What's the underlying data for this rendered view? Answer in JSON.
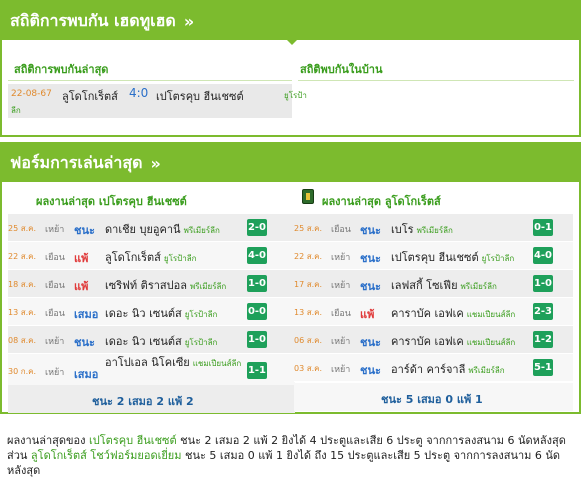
{
  "h2h": {
    "title": "สถิติการพบกัน เฮดทูเฮด",
    "chevron": "»",
    "latest_label": "สถิติการพบกันล่าสุด",
    "home_label": "สถิติพบกันในบ้าน",
    "match": {
      "date": "22-08-67",
      "home": "ลูโดโกเร็ตส์",
      "score": "4:0",
      "away": "เปโตรคุบ ฮีนเชซต์",
      "league": "ยูโรป้า",
      "league2": "ลีก"
    }
  },
  "form": {
    "title": "ฟอร์มการเล่นล่าสุด",
    "chevron": "»",
    "left_label": "ผลงานล่าสุด เปโตรคุบ ฮีนเชซต์",
    "right_label": "ผลงานล่าสุด ลูโดโกเร็ตส์",
    "team_icon": "ludogorets-crest-icon",
    "left_rows": [
      {
        "date": "25 ส.ค.",
        "ha": "เหย้า",
        "res": "ชนะ",
        "type": "win",
        "opp": "ดาเชีย บุยอูคานี",
        "lg": "พรีเมียร์ลีก",
        "score": "2-0"
      },
      {
        "date": "22 ส.ค.",
        "ha": "เยือน",
        "res": "แพ้",
        "type": "lose",
        "opp": "ลูโดโกเร็ตส์",
        "lg": "ยูโรป้าลีก",
        "score": "4-0"
      },
      {
        "date": "18 ส.ค.",
        "ha": "เยือน",
        "res": "แพ้",
        "type": "lose",
        "opp": "เซริฟท์ ติราสปอล",
        "lg": "พรีเมียร์ลีก",
        "score": "1-0"
      },
      {
        "date": "13 ส.ค.",
        "ha": "เยือน",
        "res": "เสมอ",
        "type": "draw",
        "opp": "เดอะ นิว เซนต์ส",
        "lg": "ยูโรป้าลีก",
        "score": "0-0"
      },
      {
        "date": "08 ส.ค.",
        "ha": "เหย้า",
        "res": "ชนะ",
        "type": "win",
        "opp": "เดอะ นิว เซนต์ส",
        "lg": "ยูโรป้าลีก",
        "score": "1-0"
      },
      {
        "date": "30 ก.ค.",
        "ha": "เหย้า",
        "res": "เสมอ",
        "type": "draw",
        "opp": "อาโปเอล นิโคเซีย",
        "lg": "แชมเปียนส์ลีก",
        "score": "1-1"
      }
    ],
    "right_rows": [
      {
        "date": "25 ส.ค.",
        "ha": "เยือน",
        "res": "ชนะ",
        "type": "win",
        "opp": "เบโร",
        "lg": "พรีเมียร์ลีก",
        "score": "0-1"
      },
      {
        "date": "22 ส.ค.",
        "ha": "เหย้า",
        "res": "ชนะ",
        "type": "win",
        "opp": "เปโตรคุบ ฮีนเชซต์",
        "lg": "ยูโรป้าลีก",
        "score": "4-0"
      },
      {
        "date": "17 ส.ค.",
        "ha": "เหย้า",
        "res": "ชนะ",
        "type": "win",
        "opp": "เลฟสกี้ โซเฟีย",
        "lg": "พรีเมียร์ลีก",
        "score": "1-0"
      },
      {
        "date": "13 ส.ค.",
        "ha": "เยือน",
        "res": "แพ้",
        "type": "lose",
        "opp": "คาราบัค เอฟเค",
        "lg": "แชมเปียนส์ลีก",
        "score": "2-3"
      },
      {
        "date": "06 ส.ค.",
        "ha": "เหย้า",
        "res": "ชนะ",
        "type": "win",
        "opp": "คาราบัค เอฟเค",
        "lg": "แชมเปียนส์ลีก",
        "score": "1-2"
      },
      {
        "date": "03 ส.ค.",
        "ha": "เหย้า",
        "res": "ชนะ",
        "type": "win",
        "opp": "อาร์ด้า คาร์จาลี",
        "lg": "พรีเมียร์ลีก",
        "score": "5-1"
      }
    ],
    "left_summary": "ชนะ 2 เสมอ 2 แพ้ 2",
    "right_summary": "ชนะ 5 เสมอ 0 แพ้ 1"
  },
  "note": {
    "p1": "ผลงานล่าสุดของ ",
    "team1": "เปโตรคุบ ฮีนเชซต์",
    "p2": " ชนะ 2 เสมอ 2 แพ้ 2 ยิงได้ 4 ประตูและเสีย 6 ประตู จากการลงสนาม 6 นัดหลังสุด ส่วน ",
    "team2": "ลูโดโกเร็ตส์ โชว์ฟอร์มยอดเยี่ยม",
    "p3": " ชนะ 5 เสมอ 0 แพ้ 1 ยิงได้ ถึง 15 ประตูและเสีย 5 ประตู จากการลงสนาม 6 นัดหลังสุด"
  }
}
